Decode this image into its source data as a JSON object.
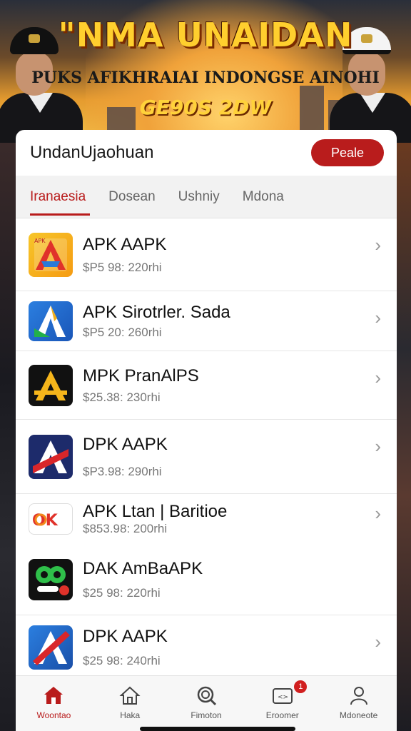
{
  "banner": {
    "title": "\"NMA UNAIDAN",
    "subtitle": "PUKS AFIKHRAIAI INDONGSE AINOHI",
    "date": "GE90S 2DW"
  },
  "header": {
    "title": "UndanUjaohuan",
    "action_label": "Peale"
  },
  "tabs": [
    {
      "label": "Iranaesia"
    },
    {
      "label": "Dosean"
    },
    {
      "label": "Ushniy"
    },
    {
      "label": "Mdona"
    }
  ],
  "apps": [
    {
      "title": "APK AAPK",
      "sub": "$P5 98: 220rhi",
      "icon": "app-icon-yellow-a"
    },
    {
      "title": "APK Sirotrler. Sada",
      "sub": "$P5 20: 260rhi",
      "icon": "app-icon-blue-a"
    },
    {
      "title": "MPK PranAlPS",
      "sub": "$25.38: 230rhi",
      "icon": "app-icon-black-a"
    },
    {
      "title": "DPK AAPK",
      "sub": "$P3.98: 290rhi",
      "icon": "app-icon-navy-a"
    },
    {
      "title": "APK Ltan | Baritioe",
      "sub": "$853.98: 200rhi",
      "icon": "app-icon-ok"
    },
    {
      "title": "DAK AmBaAPK",
      "sub": "$25 98: 220rhi",
      "icon": "app-icon-green-circle"
    },
    {
      "title": "DPK AAPK",
      "sub": "$25 98: 240rhi",
      "icon": "app-icon-blue-red-a"
    }
  ],
  "tabbar": [
    {
      "label": "Woontao",
      "icon": "home-icon"
    },
    {
      "label": "Haka",
      "icon": "house-outline-icon"
    },
    {
      "label": "Fimoton",
      "icon": "search-icon"
    },
    {
      "label": "Eroomer",
      "icon": "inbox-icon",
      "badge": "1"
    },
    {
      "label": "Mdoneote",
      "icon": "profile-icon"
    }
  ],
  "colors": {
    "accent": "#b91c1c",
    "banner_title": "#ffcf2e"
  }
}
